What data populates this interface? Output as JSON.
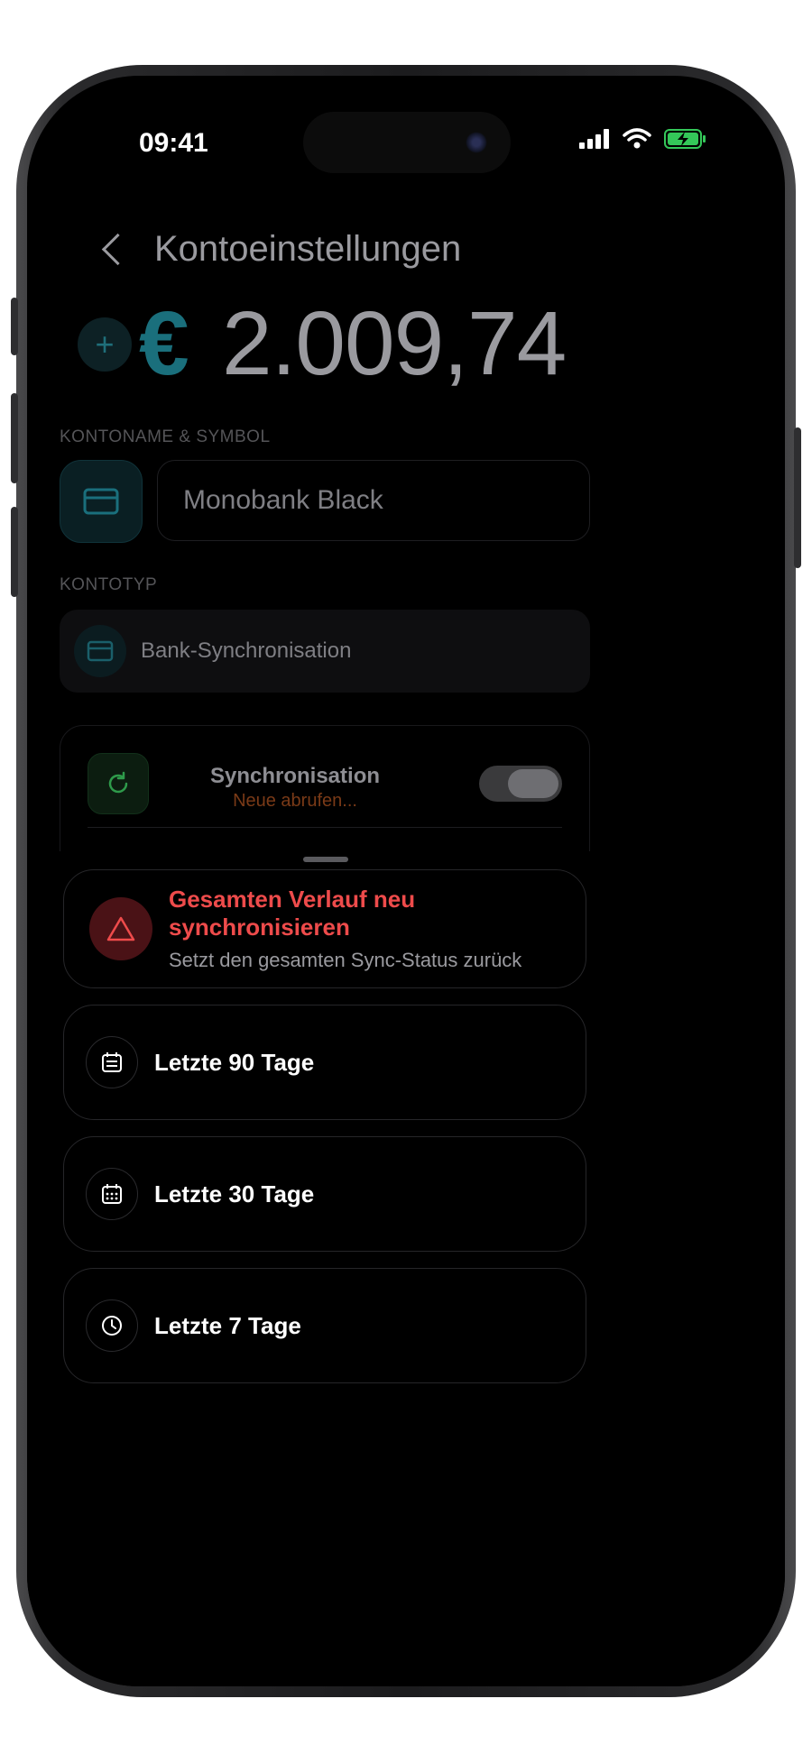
{
  "status_bar": {
    "time": "09:41"
  },
  "header": {
    "title": "Kontoeinstellungen"
  },
  "balance": {
    "currency_symbol": "€",
    "amount": "2.009,74"
  },
  "account_name_section": {
    "label": "KONTONAME & SYMBOL",
    "name_value": "Monobank Black"
  },
  "account_type_section": {
    "label": "KONTOTYP",
    "type_value": "Bank-Synchronisation"
  },
  "sync_card": {
    "title": "Synchronisation",
    "status": "Neue abrufen...",
    "toggle_on": true
  },
  "sheet": {
    "full_resync": {
      "title": "Gesamten Verlauf neu synchronisieren",
      "subtitle": "Setzt den gesamten Sync-Status zurück"
    },
    "options": [
      {
        "label": "Letzte 90 Tage",
        "icon": "calendar-list-icon"
      },
      {
        "label": "Letzte 30 Tage",
        "icon": "calendar-grid-icon"
      },
      {
        "label": "Letzte 7 Tage",
        "icon": "clock-icon"
      }
    ]
  },
  "colors": {
    "accent_teal": "#1a6f7c",
    "danger": "#ee4b4b",
    "sync_green": "#2e9a4a",
    "warning_orange": "#7a3a17"
  }
}
